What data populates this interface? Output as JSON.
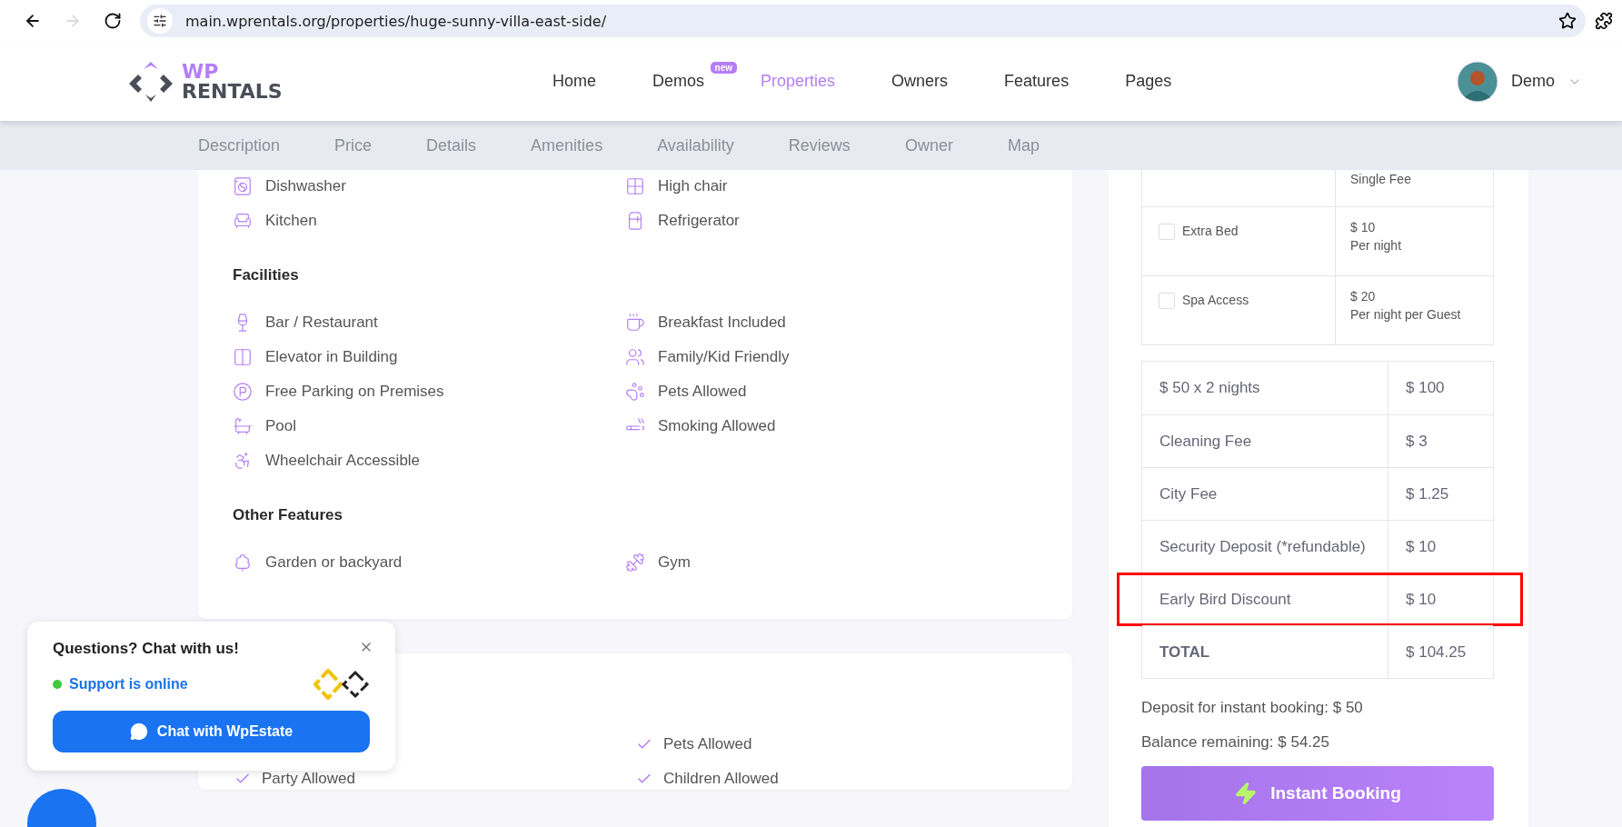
{
  "browser": {
    "url": "main.wprentals.org/properties/huge-sunny-villa-east-side/",
    "nav_buttons": [
      {
        "kind": "back",
        "disabled": false
      },
      {
        "kind": "forward",
        "disabled": true
      },
      {
        "kind": "reload",
        "disabled": false
      }
    ]
  },
  "header": {
    "logo": {
      "top": "WP",
      "bottom": "RENTALS"
    },
    "nav": [
      {
        "label": "Home",
        "selected": false
      },
      {
        "label": "Demos",
        "selected": false,
        "badge": "new"
      },
      {
        "label": "Properties",
        "selected": true
      },
      {
        "label": "Owners",
        "selected": false
      },
      {
        "label": "Features",
        "selected": false
      },
      {
        "label": "Pages",
        "selected": false
      }
    ],
    "user": "Demo"
  },
  "section_tabs": [
    "Description",
    "Price",
    "Details",
    "Amenities",
    "Availability",
    "Reviews",
    "Owner",
    "Map"
  ],
  "amenities": [
    {
      "rows": [
        [
          "Dishwasher",
          "High chair"
        ],
        [
          "Kitchen",
          "Refrigerator"
        ]
      ]
    },
    {
      "title": "Facilities",
      "rows": [
        [
          "Bar / Restaurant",
          "Breakfast Included"
        ],
        [
          "Elevator in Building",
          "Family/Kid Friendly"
        ],
        [
          "Free Parking on Premises",
          "Pets Allowed"
        ],
        [
          "Pool",
          "Smoking Allowed"
        ],
        [
          "Wheelchair Accessible"
        ]
      ]
    },
    {
      "title": "Other Features",
      "rows": [
        [
          "Garden or backyard",
          "Gym"
        ]
      ]
    }
  ],
  "rules": [
    {
      "right": "Pets Allowed"
    },
    {
      "left": "Party Allowed",
      "right": "Children Allowed"
    }
  ],
  "extras": [
    {
      "price_note": "Single Fee"
    },
    {
      "label": "Extra Bed",
      "checked": false,
      "price": "$ 10",
      "price_note": "Per night"
    },
    {
      "label": "Spa Access",
      "checked": false,
      "price": "$ 20",
      "price_note": "Per night per Guest"
    }
  ],
  "price_table": [
    {
      "label": "$ 50 x 2 nights",
      "value": "$ 100",
      "kind": "line",
      "highlighted": false
    },
    {
      "label": "Cleaning Fee",
      "value": "$ 3",
      "kind": "line",
      "highlighted": false
    },
    {
      "label": "City Fee",
      "value": "$ 1.25",
      "kind": "line",
      "highlighted": false
    },
    {
      "label": "Security Deposit (*refundable)",
      "value": "$ 10",
      "kind": "line",
      "highlighted": false
    },
    {
      "label": "Early Bird Discount",
      "value": "$ 10",
      "kind": "line",
      "highlighted": true
    },
    {
      "label": "TOTAL",
      "value": "$ 104.25",
      "kind": "total",
      "highlighted": false
    }
  ],
  "deposit": "Deposit for instant booking: $ 50",
  "balance": "Balance remaining: $ 54.25",
  "booking_button": "Instant Booking",
  "chat": {
    "title": "Questions? Chat with us!",
    "status": "Support is online",
    "online": true,
    "button": "Chat with WpEstate"
  }
}
